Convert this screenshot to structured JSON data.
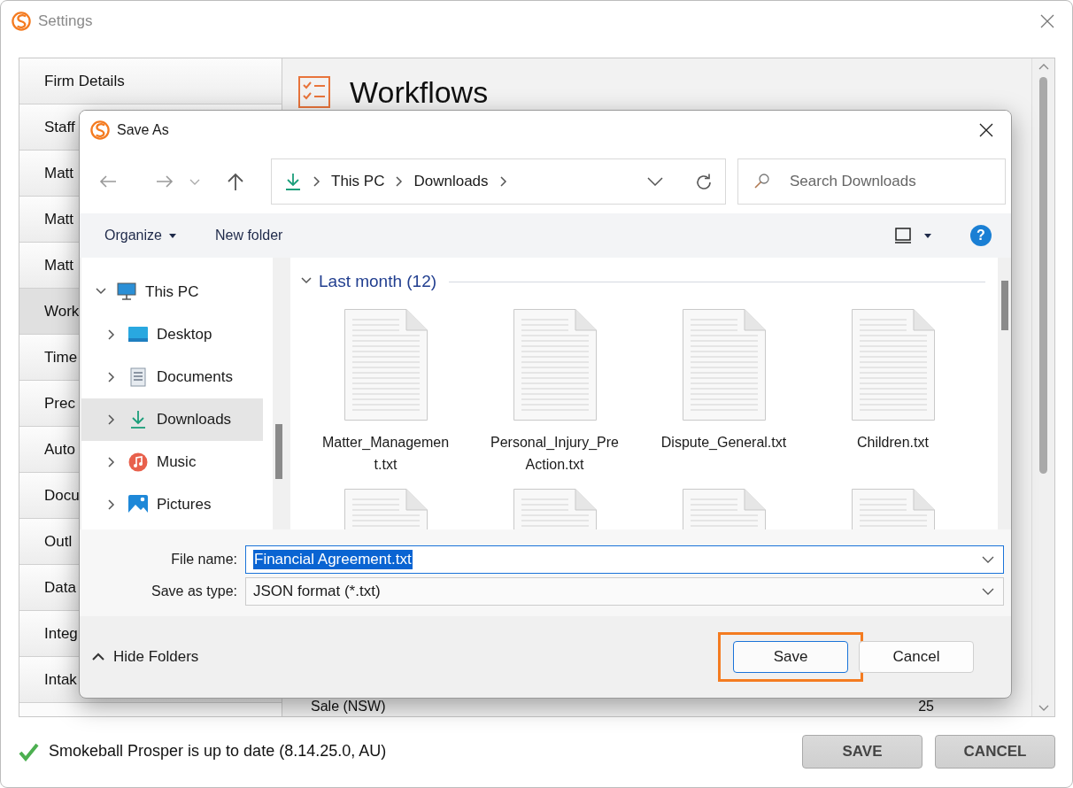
{
  "settings": {
    "title": "Settings",
    "sidebar": [
      {
        "label": "Firm Details",
        "selected": false
      },
      {
        "label": "Staff",
        "selected": false
      },
      {
        "label": "Matt",
        "selected": false
      },
      {
        "label": "Matt",
        "selected": false
      },
      {
        "label": "Matt",
        "selected": false
      },
      {
        "label": "Work",
        "selected": true
      },
      {
        "label": "Time",
        "selected": false
      },
      {
        "label": "Prec",
        "selected": false
      },
      {
        "label": "Auto",
        "selected": false
      },
      {
        "label": "Docu",
        "selected": false
      },
      {
        "label": "Outl",
        "selected": false
      },
      {
        "label": "Data",
        "selected": false
      },
      {
        "label": "Integ",
        "selected": false
      },
      {
        "label": "Intak",
        "selected": false
      }
    ],
    "heading": "Workflows",
    "rows": [
      {
        "name": "Sale (NSW)",
        "value": "25"
      }
    ],
    "status": "Smokeball Prosper is up to date (8.14.25.0, AU)",
    "buttons": [
      "SAVE",
      "CANCEL"
    ]
  },
  "save_dialog": {
    "title": "Save As",
    "breadcrumb": [
      "This PC",
      "Downloads"
    ],
    "search": {
      "placeholder": "Search Downloads"
    },
    "toolbar": {
      "organize": "Organize",
      "new_folder": "New folder",
      "help": "?"
    },
    "tree": [
      {
        "label": "This PC",
        "kind": "computer",
        "expanded": true,
        "selected": false,
        "children": [
          {
            "label": "Desktop",
            "kind": "desktop",
            "expanded": false,
            "selected": false
          },
          {
            "label": "Documents",
            "kind": "documents",
            "expanded": false,
            "selected": false
          },
          {
            "label": "Downloads",
            "kind": "downloads",
            "expanded": false,
            "selected": true
          },
          {
            "label": "Music",
            "kind": "music",
            "expanded": false,
            "selected": false
          },
          {
            "label": "Pictures",
            "kind": "pictures",
            "expanded": false,
            "selected": false
          }
        ]
      }
    ],
    "group": {
      "label": "Last month (12)",
      "expanded": true
    },
    "files": [
      {
        "kind": "named",
        "name": "Matter_Management.txt"
      },
      {
        "kind": "named",
        "name": "Personal_Injury_PreAction.txt"
      },
      {
        "kind": "named",
        "name": "Dispute_General.txt"
      },
      {
        "kind": "named",
        "name": "Children.txt"
      },
      {
        "kind": "cut"
      },
      {
        "kind": "cut"
      },
      {
        "kind": "cut"
      },
      {
        "kind": "cut"
      }
    ],
    "file_name": {
      "label": "File name:",
      "value": "Financial Agreement.txt",
      "selected": true
    },
    "save_type": {
      "label": "Save as type:",
      "value": "JSON format (*.txt)"
    },
    "hide_folders": "Hide Folders",
    "buttons": [
      {
        "label": "Save",
        "default": true,
        "highlighted": true
      },
      {
        "label": "Cancel",
        "default": false,
        "highlighted": false
      }
    ]
  }
}
